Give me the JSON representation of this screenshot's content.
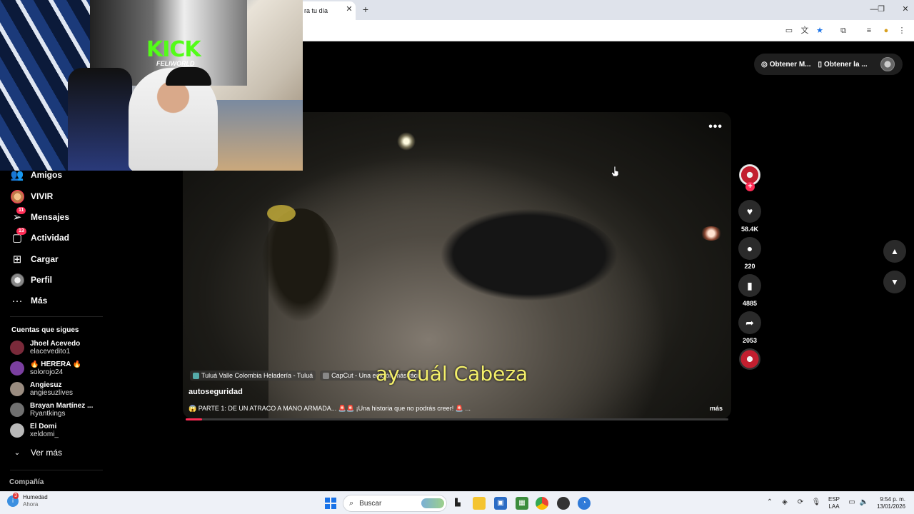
{
  "browser": {
    "tab_title": "ra tu día",
    "tab_close": "✕",
    "new_tab": "+",
    "window": {
      "minimize": "—",
      "restore": "❐",
      "close": "✕"
    }
  },
  "webcam": {
    "kick": "KICK",
    "feliworld": "FELIWORLD"
  },
  "sidebar": {
    "items": [
      {
        "label": "Amigos",
        "icon": "friends-icon"
      },
      {
        "label": "VIVIR",
        "icon": "live-avatar"
      },
      {
        "label": "Mensajes",
        "icon": "messages-icon",
        "badge": "11"
      },
      {
        "label": "Actividad",
        "icon": "activity-icon",
        "badge": "13"
      },
      {
        "label": "Cargar",
        "icon": "upload-icon"
      },
      {
        "label": "Perfil",
        "icon": "profile-avatar"
      },
      {
        "label": "Más",
        "icon": "more-icon"
      }
    ],
    "following_title": "Cuentas que sigues",
    "following": [
      {
        "name": "Jhoel Acevedo",
        "user": "elacevedito1",
        "color": "#7a2a3a"
      },
      {
        "name": "🔥 HERERA 🔥",
        "user": "solorojo24",
        "color": "#7b3fa0"
      },
      {
        "name": "Angiesuz",
        "user": "angiesuzlives",
        "color": "#9a8c80"
      },
      {
        "name": "Brayan Martínez ...",
        "user": "Ryantkings",
        "color": "#707070"
      },
      {
        "name": "El Domi",
        "user": "xeldomi_",
        "color": "#b9b9b9"
      }
    ],
    "see_more": "Ver más",
    "company": "Compañía"
  },
  "topbar": {
    "get_coins": "Obtener M...",
    "get_app": "Obtener la ..."
  },
  "video": {
    "more": "•••",
    "subtitle": "ay cuál Cabeza",
    "tags": [
      {
        "icon": "location-icon",
        "text": "Tuluá Valle Colombia Heladería - Tuluá"
      },
      {
        "icon": "capcut-icon",
        "text": "CapCut - Una edición más fácil"
      }
    ],
    "author": "autoseguridad",
    "description": "😱 PARTE 1: DE UN ATRACO A MANO ARMADA... 🚨🚨 ¡Una historia que no podrás creer! 🚨 ...",
    "more_link": "más",
    "progress": 0.03
  },
  "actions": {
    "likes": "58.4K",
    "comments": "220",
    "saves": "4885",
    "shares": "2053"
  },
  "taskbar": {
    "weather_title": "Humedad",
    "weather_sub": "Ahora",
    "weather_badge": "3",
    "search": "Buscar",
    "lang_top": "ESP",
    "lang_bottom": "LAA",
    "time": "9:54 p. m.",
    "date": "13/01/2026"
  },
  "colors": {
    "accent": "#fe2c55",
    "subtitle": "#f4f06a",
    "kick": "#53fc18"
  }
}
